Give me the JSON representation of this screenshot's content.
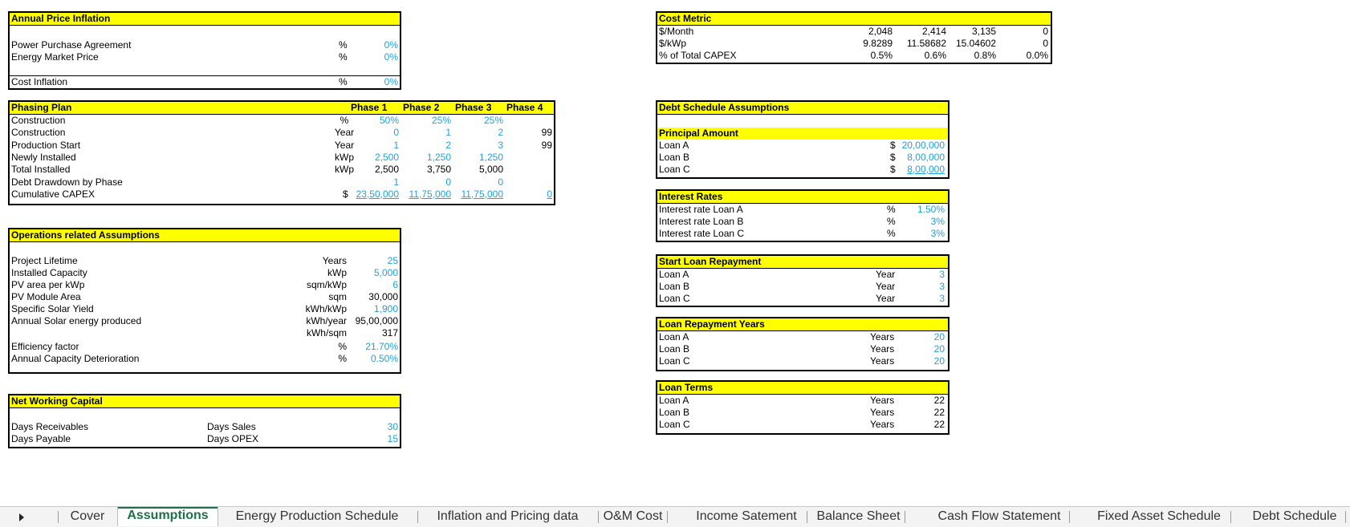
{
  "annual_price_inflation": {
    "title": "Annual Price Inflation",
    "rows": [
      {
        "label": "Power Purchase Agreement",
        "unit": "%",
        "value": "0%"
      },
      {
        "label": "Energy Market Price",
        "unit": "%",
        "value": "0%"
      },
      {
        "label": "Cost Inflation",
        "unit": "%",
        "value": "0%"
      }
    ]
  },
  "phasing_plan": {
    "title": "Phasing Plan",
    "phases": [
      "Phase 1",
      "Phase 2",
      "Phase 3",
      "Phase 4"
    ],
    "rows": [
      {
        "label": "Construction",
        "unit": "%",
        "values": [
          "50%",
          "25%",
          "25%",
          ""
        ]
      },
      {
        "label": "Construction",
        "unit": "Year",
        "values": [
          "0",
          "1",
          "2",
          "99"
        ]
      },
      {
        "label": "Production Start",
        "unit": "Year",
        "values": [
          "1",
          "2",
          "3",
          "99"
        ]
      },
      {
        "label": "Newly Installed",
        "unit": "kWp",
        "values": [
          "2,500",
          "1,250",
          "1,250",
          ""
        ]
      },
      {
        "label": "Total Installed",
        "unit": "kWp",
        "values": [
          "2,500",
          "3,750",
          "5,000",
          ""
        ]
      },
      {
        "label": "Debt Drawdown by Phase",
        "unit": "",
        "values": [
          "1",
          "0",
          "0",
          ""
        ]
      },
      {
        "label": "Cumulative CAPEX",
        "unit": "$",
        "values": [
          "23,50,000",
          "11,75,000",
          "11,75,000",
          "0"
        ]
      }
    ]
  },
  "operations": {
    "title": "Operations related Assumptions",
    "rows": [
      {
        "label": "Project Lifetime",
        "unit": "Years",
        "value": "25"
      },
      {
        "label": "Installed Capacity",
        "unit": "kWp",
        "value": "5,000"
      },
      {
        "label": "PV area per kWp",
        "unit": "sqm/kWp",
        "value": "6"
      },
      {
        "label": "PV Module Area",
        "unit": "sqm",
        "value": "30,000"
      },
      {
        "label": "Specific Solar Yield",
        "unit": "kWh/kWp",
        "value": "1,900"
      },
      {
        "label": "Annual Solar energy produced",
        "unit": "kWh/year",
        "value": "95,00,000"
      },
      {
        "label": "",
        "unit": "kWh/sqm",
        "value": "317"
      },
      {
        "label": "Efficiency factor",
        "unit": "%",
        "value": "21.70%"
      },
      {
        "label": "Annual Capacity Deterioration",
        "unit": "%",
        "value": "0.50%"
      }
    ]
  },
  "net_working_capital": {
    "title": "Net Working Capital",
    "rows": [
      {
        "label": "Days Receivables",
        "unit": "Days Sales",
        "value": "30"
      },
      {
        "label": "Days Payable",
        "unit": "Days OPEX",
        "value": "15"
      }
    ]
  },
  "cost_metric": {
    "title": "Cost Metric",
    "rows": [
      {
        "label": "$/Month",
        "values": [
          "2,048",
          "2,414",
          "3,135",
          "0"
        ]
      },
      {
        "label": "$/kWp",
        "values": [
          "9.8289",
          "11.58682",
          "15.04602",
          "0"
        ]
      },
      {
        "label": "% of Total CAPEX",
        "values": [
          "0.5%",
          "0.6%",
          "0.8%",
          "0.0%"
        ]
      }
    ]
  },
  "debt_schedule": {
    "title": "Debt Schedule Assumptions",
    "principal_title": "Principal Amount",
    "principal_rows": [
      {
        "label": "Loan A",
        "currency": "$",
        "value": "20,00,000"
      },
      {
        "label": "Loan B",
        "currency": "$",
        "value": "8,00,000"
      },
      {
        "label": "Loan C",
        "currency": "$",
        "value": "8,00,000"
      }
    ]
  },
  "interest_rates": {
    "title": "Interest Rates",
    "rows": [
      {
        "label": "Interest rate Loan A",
        "unit": "%",
        "value": "1.50%"
      },
      {
        "label": "Interest rate Loan B",
        "unit": "%",
        "value": "3%"
      },
      {
        "label": "Interest rate Loan C",
        "unit": "%",
        "value": "3%"
      }
    ]
  },
  "start_repayment": {
    "title": "Start Loan Repayment",
    "rows": [
      {
        "label": "Loan A",
        "unit": "Year",
        "value": "3"
      },
      {
        "label": "Loan B",
        "unit": "Year",
        "value": "3"
      },
      {
        "label": "Loan C",
        "unit": "Year",
        "value": "3"
      }
    ]
  },
  "repayment_years": {
    "title": "Loan Repayment Years",
    "rows": [
      {
        "label": "Loan A",
        "unit": "Years",
        "value": "20"
      },
      {
        "label": "Loan B",
        "unit": "Years",
        "value": "20"
      },
      {
        "label": "Loan C",
        "unit": "Years",
        "value": "20"
      }
    ]
  },
  "loan_terms": {
    "title": "Loan Terms",
    "rows": [
      {
        "label": "Loan A",
        "unit": "Years",
        "value": "22"
      },
      {
        "label": "Loan B",
        "unit": "Years",
        "value": "22"
      },
      {
        "label": "Loan C",
        "unit": "Years",
        "value": "22"
      }
    ]
  },
  "tabs": [
    {
      "label": "Cover"
    },
    {
      "label": "Assumptions",
      "active": true
    },
    {
      "label": "Energy Production Schedule"
    },
    {
      "label": "Inflation and Pricing data"
    },
    {
      "label": "O&M Cost"
    },
    {
      "label": "Income Satement"
    },
    {
      "label": "Balance Sheet"
    },
    {
      "label": "Cash Flow Statement"
    },
    {
      "label": "Fixed Asset Schedule"
    },
    {
      "label": "Debt Schedule"
    }
  ],
  "colors": {
    "header": "#ffff00",
    "input_blue": "#1fa2e0",
    "active_tab": "#1e7145"
  },
  "icons": {
    "sheet_nav": "triangle-right-icon"
  }
}
